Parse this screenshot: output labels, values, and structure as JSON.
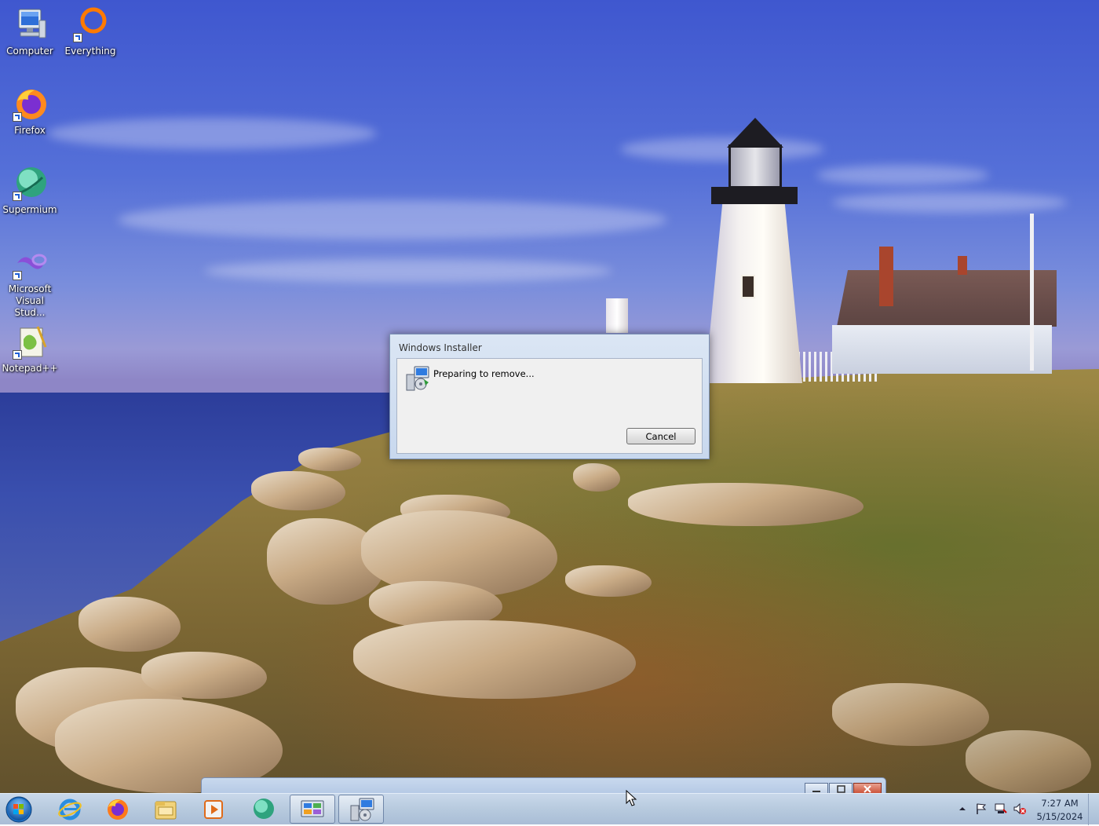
{
  "desktop": {
    "icons": [
      {
        "label": "Computer"
      },
      {
        "label": "Everything"
      },
      {
        "label": "Firefox"
      },
      {
        "label": "Supermium"
      },
      {
        "label": "Microsoft Visual Stud..."
      },
      {
        "label": "Notepad++"
      }
    ]
  },
  "dialog": {
    "title": "Windows Installer",
    "message": "Preparing to remove...",
    "cancel_label": "Cancel"
  },
  "taskbar": {
    "pinned": [
      "start-orb",
      "internet-explorer-icon",
      "firefox-icon",
      "file-explorer-icon",
      "media-player-icon",
      "supermium-icon",
      "control-panel-icon",
      "windows-installer-icon"
    ],
    "clock": {
      "time": "7:27 AM",
      "date": "5/15/2024"
    }
  },
  "colors": {
    "taskbar": "#b7cade",
    "dialog_frame": "#c8d8ee",
    "dialog_client": "#f0f0f0"
  }
}
